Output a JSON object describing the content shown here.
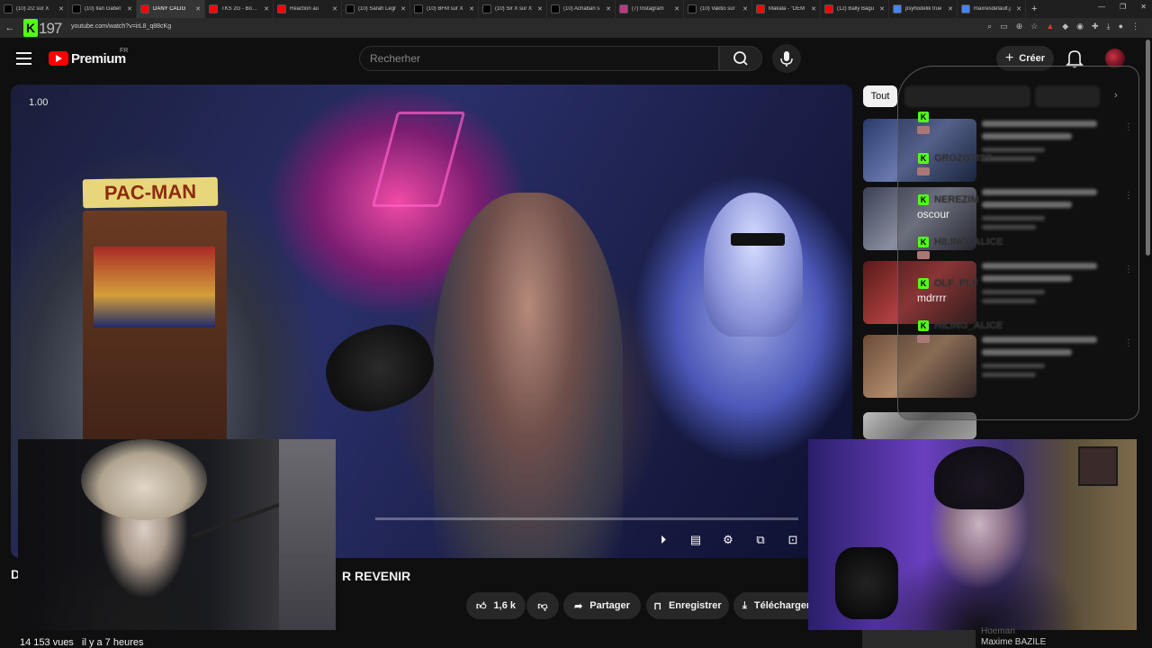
{
  "browser": {
    "tabs": [
      {
        "label": "(10) 2/2 sur X",
        "color": "#000000"
      },
      {
        "label": "(10) Ilan Gabet",
        "color": "#000000"
      },
      {
        "label": "DANY CALIG",
        "color": "#ff0000",
        "active": true
      },
      {
        "label": "TKS 2G - Bouce",
        "color": "#ff0000"
      },
      {
        "label": "Réaction au",
        "color": "#ff0000"
      },
      {
        "label": "(10) Sarah Legr",
        "color": "#000000"
      },
      {
        "label": "(10) BFM sur X",
        "color": "#000000"
      },
      {
        "label": "(10) Sir X sur X",
        "color": "#000000"
      },
      {
        "label": "(10) Achaban s",
        "color": "#000000"
      },
      {
        "label": "(7) Instagram",
        "color": "#c13584"
      },
      {
        "label": "(10) Vaktio sur",
        "color": "#000000"
      },
      {
        "label": "Makala - \"DEM",
        "color": "#ff0000"
      },
      {
        "label": "(12) Bally Bagu",
        "color": "#ff0000"
      },
      {
        "label": "psyhodelik true",
        "color": "#4285f4"
      },
      {
        "label": "maxresdefault.j",
        "color": "#4285f4"
      }
    ],
    "url": "youtube.com/watch?v=irL8_q88cKg",
    "overlay_badge_letter": "K",
    "overlay_badge_number": "197"
  },
  "header": {
    "brand": "Premium",
    "brand_region": "FR",
    "search_placeholder": "Recherher",
    "create_label": "Créer"
  },
  "player": {
    "zoom_level": "1.00",
    "title_start": "D",
    "title_end": "R REVENIR"
  },
  "actions": {
    "likes": "1,6 k",
    "share": "Partager",
    "save": "Enregistrer",
    "download": "Télécharger"
  },
  "meta": {
    "views": "14 153 vues",
    "age": "il y a 7 heures"
  },
  "filters": {
    "active": "Tout"
  },
  "chat": [
    {
      "user": "GROZOTIST",
      "message": ""
    },
    {
      "user": "NEREZIM",
      "message": "oscour"
    },
    {
      "user": "HILING_ALICE",
      "message": ""
    },
    {
      "user": "OLF_PLF",
      "message": "mdrrrr"
    },
    {
      "user": "HILING_ALICE",
      "message": ""
    }
  ],
  "recommendation": {
    "channel_name": "Maxime BAZILE",
    "channel_ghost": "Hoeman"
  },
  "colors": {
    "youtube_red": "#ff0000",
    "kick_green": "#53fc18",
    "background": "#0f0f0f"
  }
}
